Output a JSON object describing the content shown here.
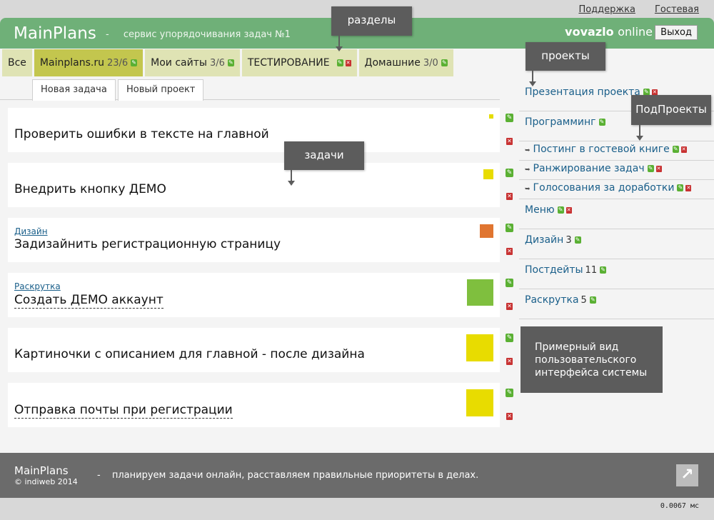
{
  "toplinks": {
    "support": "Поддержка",
    "guestbook": "Гостевая"
  },
  "header": {
    "logo": "MainPlans",
    "dash": "-",
    "tagline": "сервис упорядочивания задач №1",
    "username": "vovazlo",
    "online": "online",
    "logout": "Выход"
  },
  "tabs": [
    {
      "label": "Все"
    },
    {
      "label": "Mainplans.ru",
      "count": "23/6"
    },
    {
      "label": "Мои сайты",
      "count": "3/6"
    },
    {
      "label": "ТЕСТИРОВАНИЕ"
    },
    {
      "label": "Домашние",
      "count": "3/0"
    }
  ],
  "subtabs": {
    "new_task": "Новая задача",
    "new_project": "Новый проект"
  },
  "tasks": [
    {
      "category": "",
      "title": "Проверить ошибки в тексте на главной",
      "priority_color": "#e4dc00"
    },
    {
      "category": "",
      "title": "Внедрить кнопку ДЕМО",
      "priority_color": "#e8dc00"
    },
    {
      "category": "Дизайн",
      "title": "Задизайнить регистрационную страницу",
      "priority_color": "#e07530"
    },
    {
      "category": "Раскрутка",
      "title": "Создать ДЕМО аккаунт",
      "priority_color": "#7fbf3e"
    },
    {
      "category": "",
      "title": "Картиночки с описанием для главной - после дизайна",
      "priority_color": "#e8dc00"
    },
    {
      "category": "",
      "title": "Отправка почты при регистрации",
      "priority_color": "#e8dc00"
    }
  ],
  "projects": {
    "presentation": "Презентация проекта",
    "programming": "Программинг",
    "subprojects": [
      "Постинг в гостевой книге",
      "Ранжирование задач",
      "Голосования за доработки"
    ],
    "menu": "Меню",
    "design": {
      "label": "Дизайн",
      "count": "3"
    },
    "posts": {
      "label": "Постдейты",
      "count": "11"
    },
    "promotion": {
      "label": "Раскрутка",
      "count": "5"
    }
  },
  "callouts": {
    "sections": "разделы",
    "projects": "проекты",
    "subprojects": "ПодПроекты",
    "tasks": "задачи"
  },
  "note": "Примерный вид пользовательского интерфейса системы",
  "footer": {
    "brand": "MainPlans",
    "copyright": "© indiweb 2014",
    "dash": "-",
    "text": "планируем задачи онлайн, расставляем правильные приоритеты в делах."
  },
  "timing": "0.0067 мс",
  "colors": {
    "header": "#6fb078",
    "tab": "#dfe3b4",
    "tab_active": "#c3c64e",
    "footer": "#6b6b6b",
    "callout": "#5c5c5c"
  },
  "icons": {
    "edit": "edit-icon",
    "delete": "delete-icon",
    "subproject": "subproject-arrow-icon",
    "scroll_up": "scroll-up-icon"
  }
}
